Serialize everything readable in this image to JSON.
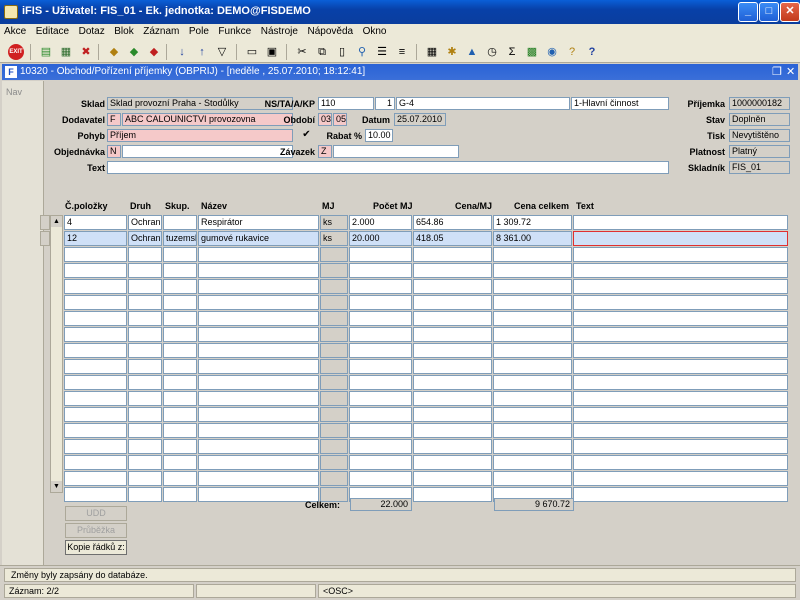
{
  "window": {
    "title": "iFIS - Uživatel: FIS_01 - Ek. jednotka: DEMO@FISDEMO"
  },
  "menu": [
    "Akce",
    "Editace",
    "Dotaz",
    "Blok",
    "Záznam",
    "Pole",
    "Funkce",
    "Nástroje",
    "Nápověda",
    "Okno"
  ],
  "inner_window": {
    "title": "10320 - Obchod/Pořízení příjemky (OBPRIJ) - [neděle , 25.07.2010; 18:12:41]"
  },
  "nav_label": "Nav",
  "form": {
    "sklad": {
      "label": "Sklad",
      "value": "Sklad provozní Praha - Stodůlky"
    },
    "dodavatel": {
      "label": "Dodavatel",
      "flag": "F",
      "value": "ABC CALOUNICTVI provozovna"
    },
    "pohyb": {
      "label": "Pohyb",
      "value": "Příjem"
    },
    "objednavka": {
      "label": "Objednávka",
      "flag": "N",
      "value": ""
    },
    "text": {
      "label": "Text",
      "value": ""
    },
    "ns": {
      "label": "NS/TA/A/KP",
      "v1": "110",
      "v2": "1",
      "v3": "G-4",
      "v4": "1-Hlavní činnost"
    },
    "obdobi": {
      "label": "Období",
      "v1": "03",
      "v2": "05"
    },
    "datum": {
      "label": "Datum",
      "value": "25.07.2010"
    },
    "rabat": {
      "label": "Rabat %",
      "value": "10.00",
      "checked": "✔"
    },
    "zavazek": {
      "label": "Závazek",
      "flag": "Z",
      "value": ""
    },
    "prijemka": {
      "label": "Příjemka",
      "value": "1000000182"
    },
    "stav": {
      "label": "Stav",
      "value": "Doplněn"
    },
    "tisk": {
      "label": "Tisk",
      "value": "Nevytištěno"
    },
    "platnost": {
      "label": "Platnost",
      "value": "Platný"
    },
    "skladnik": {
      "label": "Skladník",
      "value": "FIS_01"
    }
  },
  "table": {
    "headers": [
      "Č.položky",
      "Druh",
      "Skup.",
      "Název",
      "MJ",
      "Počet MJ",
      "Cena/MJ",
      "Cena celkem",
      "Text"
    ],
    "rows": [
      [
        "4",
        "Ochranr",
        "",
        "Respirátor",
        "ks",
        "2.000",
        "654.86",
        "1 309.72",
        ""
      ],
      [
        "12",
        "Ochranr",
        "tuzemsk",
        "gumové rukavice",
        "ks",
        "20.000",
        "418.05",
        "8 361.00",
        ""
      ]
    ]
  },
  "totals": {
    "label": "Celkem:",
    "pocet": "22.000",
    "cena": "9 670.72"
  },
  "buttons": {
    "udd": "UDD",
    "pruvodka": "Průběžka",
    "kopie": "Kopie řádků z:"
  },
  "status": {
    "message": "Změny byly zapsány do databáze.",
    "record": "Záznam: 2/2",
    "mode": "<OSC>"
  }
}
